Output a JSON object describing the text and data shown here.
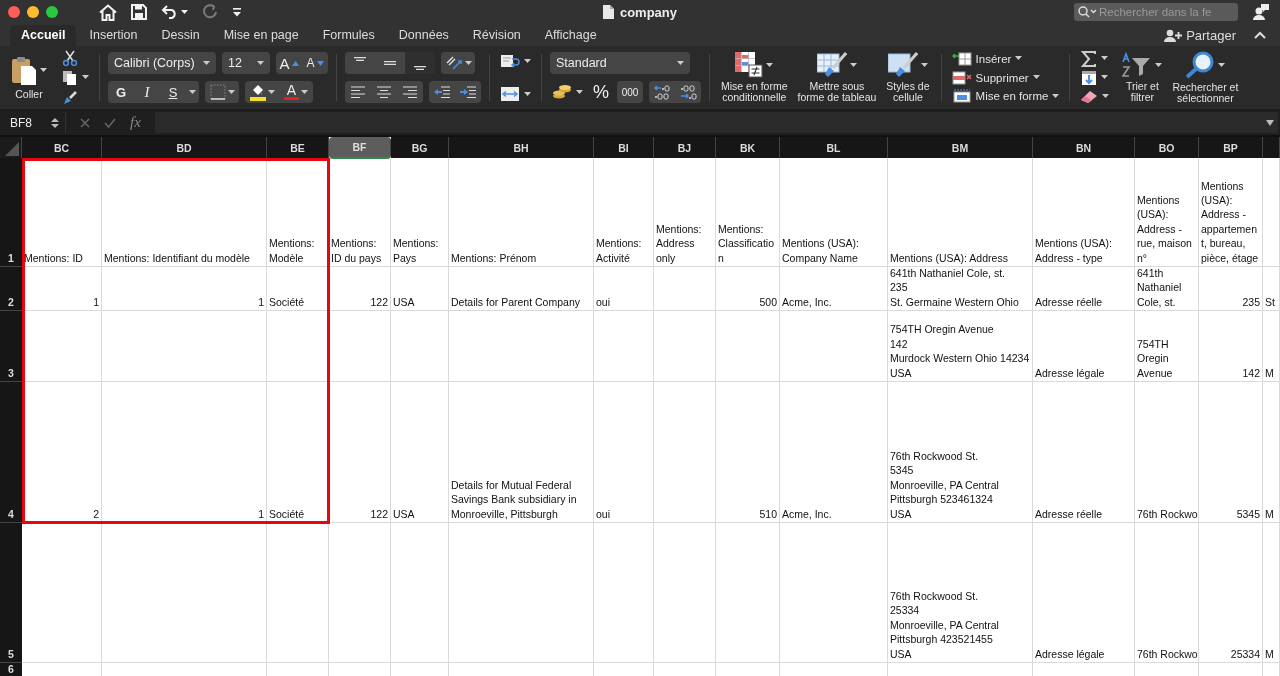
{
  "window": {
    "title": "company"
  },
  "quick_access": [
    {
      "kind": "home",
      "disabled": false
    },
    {
      "kind": "save",
      "disabled": false
    },
    {
      "kind": "undo",
      "disabled": false
    },
    {
      "kind": "redo",
      "disabled": true
    },
    {
      "kind": "customize",
      "disabled": false
    }
  ],
  "search": {
    "placeholder": "Rechercher dans la fe"
  },
  "tabs": [
    {
      "label": "Accueil",
      "selected": true
    },
    {
      "label": "Insertion",
      "selected": false
    },
    {
      "label": "Dessin",
      "selected": false
    },
    {
      "label": "Mise en page",
      "selected": false
    },
    {
      "label": "Formules",
      "selected": false
    },
    {
      "label": "Données",
      "selected": false
    },
    {
      "label": "Révision",
      "selected": false
    },
    {
      "label": "Affichage",
      "selected": false
    }
  ],
  "share": {
    "label": "Partager"
  },
  "ribbon": {
    "paste": {
      "label": "Coller"
    },
    "font": {
      "name": "Calibri (Corps)",
      "size": "12",
      "grow": "A",
      "shrink": "A",
      "bold": "G",
      "italic": "I",
      "underline": "S",
      "font_color": "A"
    },
    "vertical_align": [
      {
        "kind": "top",
        "selected": false
      },
      {
        "kind": "middle",
        "selected": false
      },
      {
        "kind": "bottom",
        "selected": true
      }
    ],
    "number": {
      "format": "Standard",
      "percent": "%",
      "thousands": "000"
    },
    "styles": [
      {
        "kind": "conditional",
        "label": "Mise en forme\nconditionnelle"
      },
      {
        "kind": "table",
        "label": "Mettre sous\nforme de tableau"
      },
      {
        "kind": "cell",
        "label": "Styles de\ncellule"
      }
    ],
    "cells": [
      {
        "kind": "insert",
        "label": "Insérer"
      },
      {
        "kind": "delete",
        "label": "Supprimer"
      },
      {
        "kind": "format",
        "label": "Mise en forme"
      }
    ],
    "editing": [
      {
        "kind": "sort",
        "label": "Trier et\nfiltrer"
      },
      {
        "kind": "find",
        "label": "Rechercher et\nsélectionner"
      }
    ]
  },
  "formula_bar": {
    "name_box": "BF8",
    "fx": "fx"
  },
  "annotation": {
    "kind": "outline"
  },
  "sheet": {
    "columns": [
      {
        "letter": "BC",
        "kind": "number",
        "selected": false
      },
      {
        "letter": "BD",
        "kind": "number",
        "selected": false
      },
      {
        "letter": "BE",
        "kind": "text",
        "selected": false
      },
      {
        "letter": "BF",
        "kind": "number",
        "selected": true
      },
      {
        "letter": "BG",
        "kind": "text",
        "selected": false
      },
      {
        "letter": "BH",
        "kind": "text",
        "selected": false
      },
      {
        "letter": "BI",
        "kind": "text",
        "selected": false
      },
      {
        "letter": "BJ",
        "kind": "text",
        "selected": false
      },
      {
        "letter": "BK",
        "kind": "number",
        "selected": false
      },
      {
        "letter": "BL",
        "kind": "text",
        "selected": false
      },
      {
        "letter": "BM",
        "kind": "text",
        "selected": false
      },
      {
        "letter": "BN",
        "kind": "text",
        "selected": false
      },
      {
        "letter": "BO",
        "kind": "text",
        "selected": false
      },
      {
        "letter": "BP",
        "kind": "number",
        "selected": false
      },
      {
        "kind": "text",
        "selected": false
      }
    ],
    "rows": [
      {
        "number": "1",
        "kind": "header",
        "cells": [
          "Mentions: ID",
          "Mentions: Identifiant du modèle",
          "Mentions:\nModèle",
          "Mentions:\nID du pays",
          "Mentions:\nPays",
          "Mentions: Prénom",
          "Mentions:\nActivité",
          "Mentions:\nAddress\nonly",
          "Mentions:\nClassificatio\nn",
          "Mentions (USA):\nCompany Name",
          "Mentions (USA): Address",
          "Mentions (USA):\nAddress - type",
          "Mentions\n(USA):\nAddress -\nrue, maison\nn°",
          "Mentions\n(USA):\nAddress -\nappartemen\nt, bureau,\npièce, étage",
          null
        ]
      },
      {
        "number": "2",
        "kind": "data",
        "cells": [
          "1",
          "1",
          "Société",
          "122",
          "USA",
          "Details for Parent Company",
          "oui",
          null,
          "500",
          "Acme, Inc.",
          "641th Nathaniel Cole, st.\n235\nSt. Germaine Western Ohio",
          "Adresse réelle",
          "641th\nNathaniel\nCole, st.",
          "235",
          "St"
        ]
      },
      {
        "number": "3",
        "kind": "data",
        "cells": [
          null,
          null,
          null,
          null,
          null,
          null,
          null,
          null,
          null,
          null,
          "754TH Oregin Avenue\n142\nMurdock Western Ohio 14234\nUSA",
          "Adresse légale",
          "754TH\nOregin\nAvenue",
          "142",
          "M"
        ]
      },
      {
        "number": "4",
        "kind": "data",
        "cells": [
          "2",
          "1",
          "Société",
          "122",
          "USA",
          "Details for Mutual Federal\nSavings Bank subsidiary in\nMonroeville, Pittsburgh",
          "oui",
          null,
          "510",
          "Acme, Inc.",
          "76th Rockwood St.\n5345\nMonroeville, PA Central\nPittsburgh 523461324\nUSA",
          "Adresse réelle",
          "76th Rockwo",
          "5345",
          "M"
        ]
      },
      {
        "number": "5",
        "kind": "data",
        "cells": [
          null,
          null,
          null,
          null,
          null,
          null,
          null,
          null,
          null,
          null,
          "76th Rockwood St.\n25334\nMonroeville, PA Central\nPittsburgh 423521455\nUSA",
          "Adresse légale",
          "76th Rockwo",
          "25334",
          "M"
        ]
      },
      {
        "number": "6",
        "kind": "data",
        "cells": [
          null,
          null,
          null,
          null,
          null,
          null,
          null,
          null,
          null,
          null,
          null,
          null,
          null,
          null,
          null
        ]
      }
    ]
  }
}
